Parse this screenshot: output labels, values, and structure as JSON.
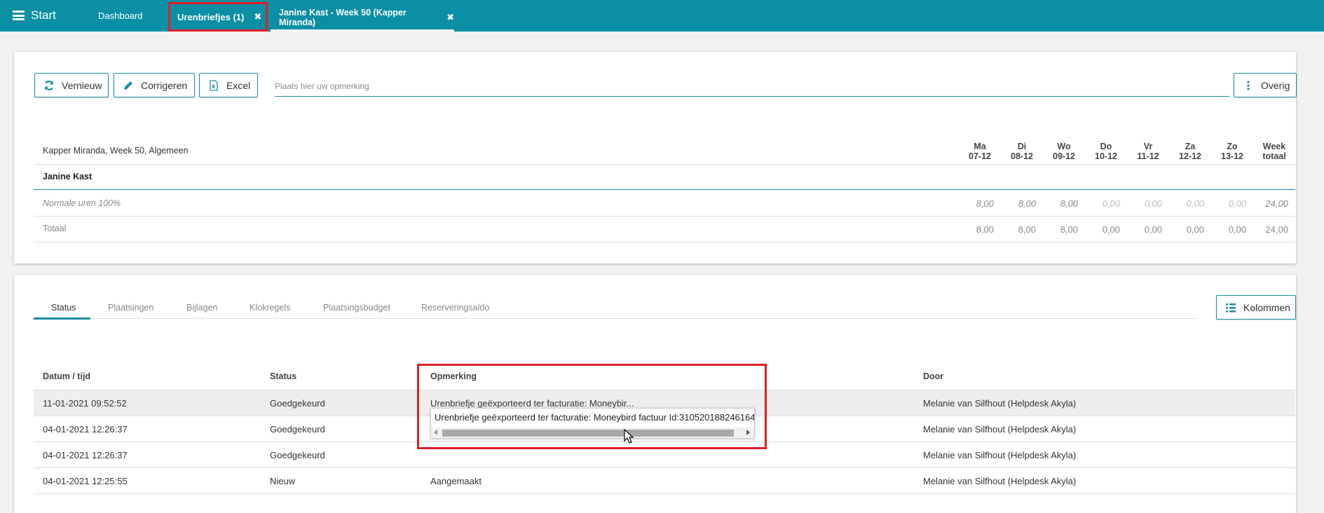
{
  "topbar": {
    "start_label": "Start",
    "tabs": [
      {
        "label": "Dashboard"
      },
      {
        "label": "Urenbriefjes (1)",
        "close": "✖"
      },
      {
        "label": "Janine Kast - Week 50 (Kapper Miranda)",
        "close": "✖"
      }
    ]
  },
  "toolbar": {
    "refresh_label": "Vernieuw",
    "correct_label": "Corrigeren",
    "excel_label": "Excel",
    "remark_placeholder": "Plaats hier uw opmerking",
    "more_label": "Overig"
  },
  "week": {
    "title": "Kapper Miranda, Week 50, Algemeen",
    "days": [
      {
        "day": "Ma",
        "date": "07-12"
      },
      {
        "day": "Di",
        "date": "08-12"
      },
      {
        "day": "Wo",
        "date": "09-12"
      },
      {
        "day": "Do",
        "date": "10-12"
      },
      {
        "day": "Vr",
        "date": "11-12"
      },
      {
        "day": "Za",
        "date": "12-12"
      },
      {
        "day": "Zo",
        "date": "13-12"
      },
      {
        "day": "Week",
        "date": "totaal"
      }
    ],
    "employee": "Janine Kast",
    "normal_label": "Normale uren 100%",
    "normal_values": [
      "8,00",
      "8,00",
      "8,00",
      "0,00",
      "0,00",
      "0,00",
      "0,00",
      "24,00"
    ],
    "total_label": "Totaal",
    "total_values": [
      "8,00",
      "8,00",
      "8,00",
      "0,00",
      "0,00",
      "0,00",
      "0,00",
      "24,00"
    ]
  },
  "subtabs": [
    "Status",
    "Plaatsingen",
    "Bijlagen",
    "Klokregels",
    "Plaatsingsbudget",
    "Reserveringsaldo"
  ],
  "columns_button": "Kolommen",
  "status_table": {
    "headers": [
      "Datum / tijd",
      "Status",
      "Opmerking",
      "Door"
    ],
    "rows": [
      {
        "datetime": "11-01-2021 09:52:52",
        "status": "Goedgekeurd",
        "remark": "Urenbriefje geëxporteerd ter facturatie: Moneybir...",
        "by": "Melanie van Silfhout (Helpdesk Akyla)"
      },
      {
        "datetime": "04-01-2021 12:26:37",
        "status": "Goedgekeurd",
        "remark": "",
        "by": "Melanie van Silfhout (Helpdesk Akyla)"
      },
      {
        "datetime": "04-01-2021 12:26:37",
        "status": "Goedgekeurd",
        "remark": "",
        "by": "Melanie van Silfhout (Helpdesk Akyla)"
      },
      {
        "datetime": "04-01-2021 12:25:55",
        "status": "Nieuw",
        "remark": "Aangemaakt",
        "by": "Melanie van Silfhout (Helpdesk Akyla)"
      }
    ]
  },
  "tooltip": {
    "text": "Urenbriefje geëxporteerd ter facturatie: Moneybird factuur Id:310520188246164"
  },
  "colors": {
    "accent": "#0a8fa5",
    "highlight": "#e01e26"
  }
}
